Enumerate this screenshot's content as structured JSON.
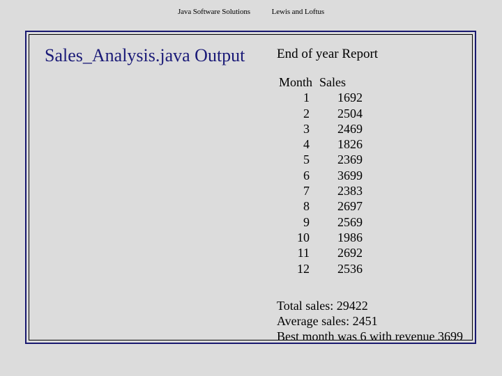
{
  "header": {
    "book_title": "Java Software Solutions",
    "authors": "Lewis and Loftus"
  },
  "slide": {
    "title": "Sales_Analysis.java Output",
    "title_color": "#1b1b78",
    "border_color": "#191970",
    "inner_border_color": "#000000",
    "background_color": "#dcdcdc"
  },
  "output": {
    "heading": "End of year Report",
    "table": {
      "columns": [
        "Month",
        "Sales"
      ],
      "rows": [
        {
          "month": "1",
          "sales": "1692"
        },
        {
          "month": "2",
          "sales": "2504"
        },
        {
          "month": "3",
          "sales": "2469"
        },
        {
          "month": "4",
          "sales": "1826"
        },
        {
          "month": "5",
          "sales": "2369"
        },
        {
          "month": "6",
          "sales": "3699"
        },
        {
          "month": "7",
          "sales": "2383"
        },
        {
          "month": "8",
          "sales": "2697"
        },
        {
          "month": "9",
          "sales": "2569"
        },
        {
          "month": "10",
          "sales": "1986"
        },
        {
          "month": "11",
          "sales": "2692"
        },
        {
          "month": "12",
          "sales": "2536"
        }
      ]
    },
    "summary": [
      "Total sales: 29422",
      "Average sales: 2451",
      "Best month was 6 with revenue 3699"
    ]
  }
}
